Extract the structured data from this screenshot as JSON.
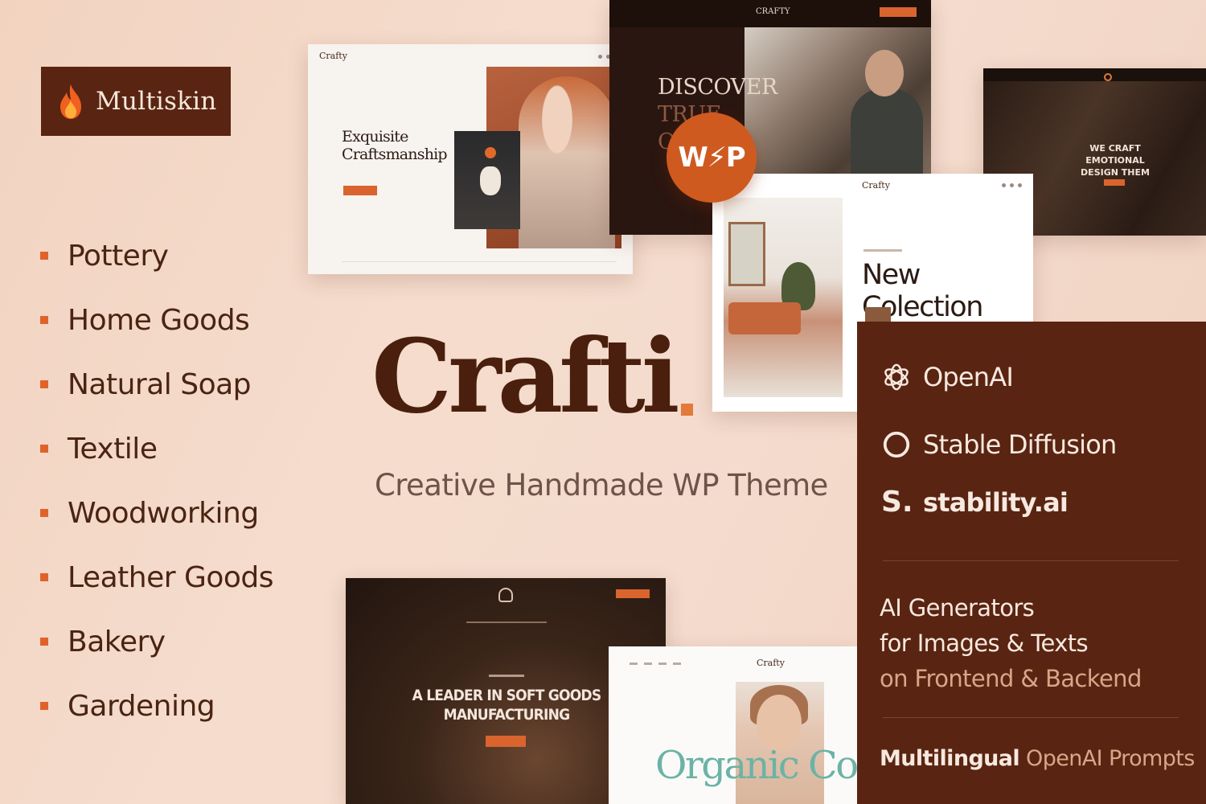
{
  "badge": {
    "label": "Multiskin",
    "icon": "flame-icon",
    "icon_color": "#f0601f"
  },
  "categories": [
    "Pottery",
    "Home Goods",
    "Natural Soap",
    "Textile",
    "Woodworking",
    "Leather Goods",
    "Bakery",
    "Gardening"
  ],
  "brand": {
    "name": "Crafti",
    "tagline": "Creative Handmade WP Theme",
    "accent": "#e4793a"
  },
  "wp_badge": {
    "label": "W⚡P"
  },
  "screenshots": {
    "shot1": {
      "logo": "Crafty",
      "heading": "Exquisite Craftsmanship"
    },
    "shot2": {
      "logo": "CRAFTY",
      "headline_line1": "DISCOVER",
      "headline_line2": "TRUE",
      "headline_line3": "O"
    },
    "shot3": {
      "headline": "WE CRAFT EMOTIONAL DESIGN THEM"
    },
    "shot4": {
      "logo": "Crafty",
      "heading": "New Colection"
    },
    "shot5": {
      "headline": "A LEADER IN SOFT GOODS MANUFACTURING"
    },
    "shot6": {
      "logo": "Crafty",
      "heading": "Organic Cosmetics"
    }
  },
  "ai_panel": {
    "providers": [
      {
        "name": "OpenAI",
        "icon": "openai-icon"
      },
      {
        "name": "Stable Diffusion",
        "icon": "stable-diffusion-icon"
      },
      {
        "name": "stability.ai",
        "icon": "stability-icon",
        "icon_glyph": "S."
      }
    ],
    "feature_line1": "AI Generators",
    "feature_line2": "for Images & Texts",
    "feature_line3": "on Frontend & Backend",
    "multilingual_strong": "Multilingual",
    "multilingual_rest": " OpenAI Prompts"
  },
  "colors": {
    "panel_bg": "#5a2412",
    "brand_dark": "#4a1f0e",
    "accent_orange": "#d9642e",
    "background": "#f4d9c9"
  }
}
